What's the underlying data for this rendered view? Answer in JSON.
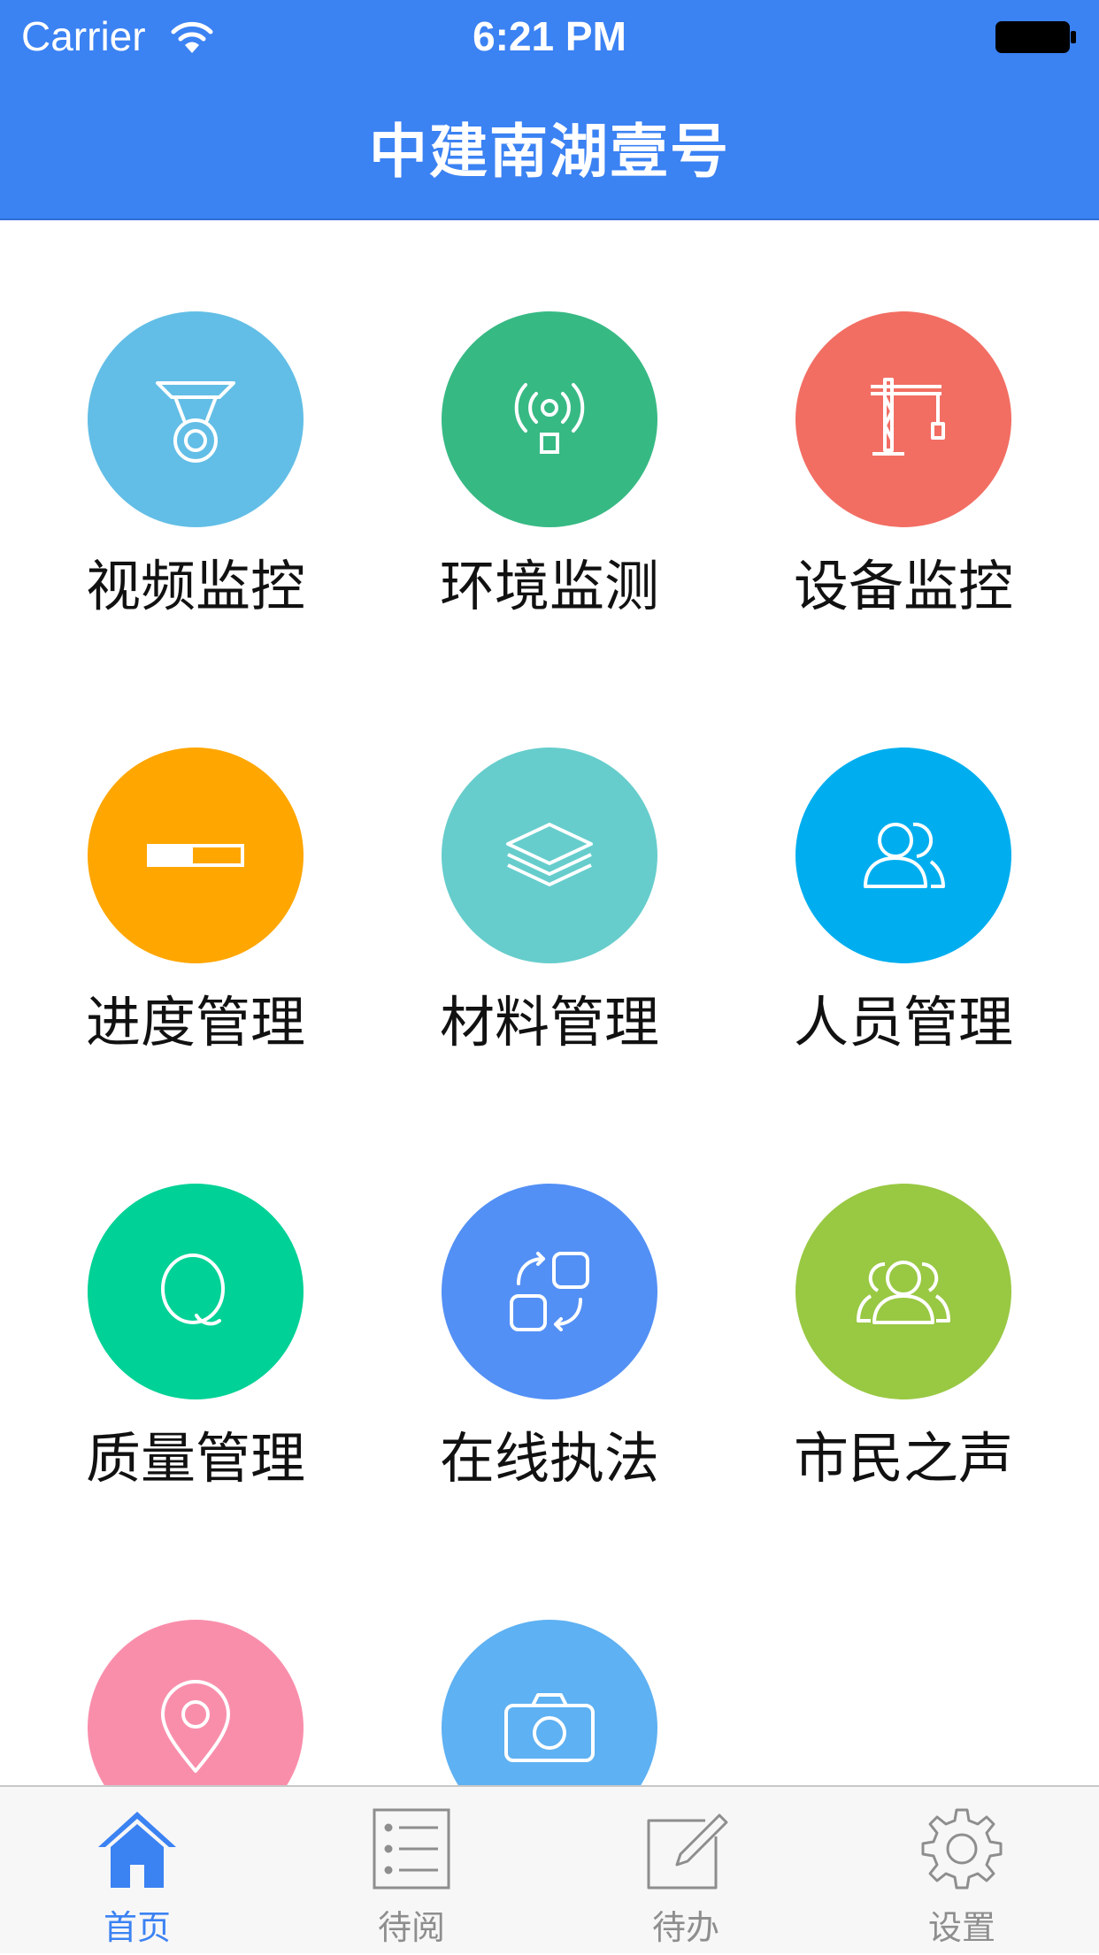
{
  "status_bar": {
    "carrier": "Carrier",
    "time": "6:21 PM"
  },
  "header": {
    "title": "中建南湖壹号"
  },
  "tiles": [
    {
      "label": "视频监控",
      "icon": "cctv-camera-icon",
      "color": "#62bee6"
    },
    {
      "label": "环境监测",
      "icon": "broadcast-sensor-icon",
      "color": "#37b984"
    },
    {
      "label": "设备监控",
      "icon": "tower-crane-icon",
      "color": "#f26e63"
    },
    {
      "label": "进度管理",
      "icon": "progress-bar-icon",
      "color": "#ffa600"
    },
    {
      "label": "材料管理",
      "icon": "layers-icon",
      "color": "#66cdcc"
    },
    {
      "label": "人员管理",
      "icon": "users-icon",
      "color": "#00aeef"
    },
    {
      "label": "质量管理",
      "icon": "quality-q-icon",
      "color": "#00d196"
    },
    {
      "label": "在线执法",
      "icon": "swap-exchange-icon",
      "color": "#5390f5"
    },
    {
      "label": "市民之声",
      "icon": "group-icon",
      "color": "#99c843"
    },
    {
      "label": "",
      "icon": "location-pin-icon",
      "color": "#f98eab"
    },
    {
      "label": "",
      "icon": "camera-icon",
      "color": "#5eb1f2"
    }
  ],
  "tabbar": {
    "active_color": "#3b82f3",
    "inactive_color": "#8e8e8e",
    "tabs": [
      {
        "label": "首页",
        "icon": "home-icon",
        "active": true
      },
      {
        "label": "待阅",
        "icon": "list-icon",
        "active": false
      },
      {
        "label": "待办",
        "icon": "edit-icon",
        "active": false
      },
      {
        "label": "设置",
        "icon": "gear-icon",
        "active": false
      }
    ]
  }
}
